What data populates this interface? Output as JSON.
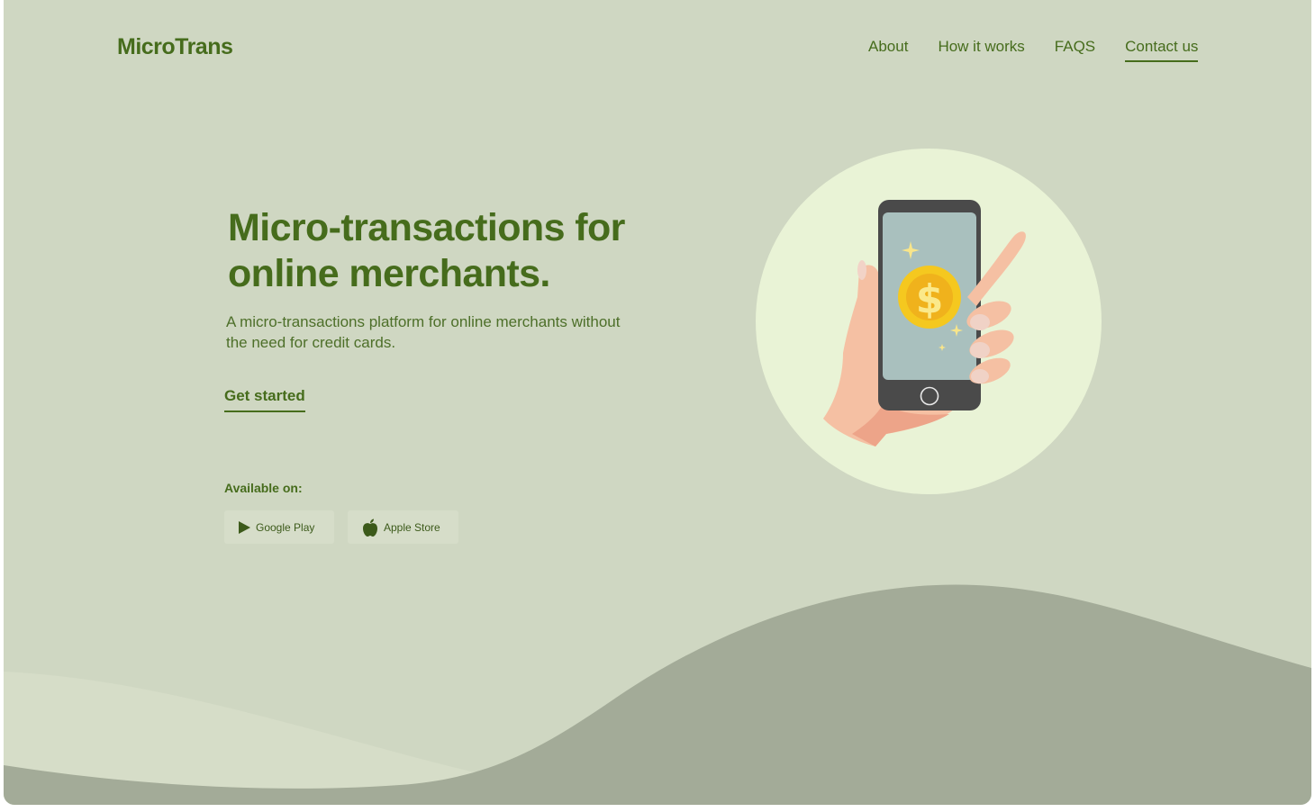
{
  "brand": {
    "name": "MicroTrans"
  },
  "nav": {
    "items": [
      {
        "label": "About"
      },
      {
        "label": "How it works"
      },
      {
        "label": "FAQS"
      },
      {
        "label": "Contact us"
      }
    ]
  },
  "hero": {
    "title": "Micro-transactions for online merchants.",
    "subtitle": "A micro-transactions platform for online merchants without the need for credit cards.",
    "cta_label": "Get started"
  },
  "availability": {
    "heading": "Available on:",
    "stores": [
      {
        "label": "Google Play",
        "icon": "google-play-icon"
      },
      {
        "label": "Apple Store",
        "icon": "apple-icon"
      }
    ]
  },
  "illustration": {
    "icon": "hand-phone-dollar-illustration"
  },
  "colors": {
    "page_bg": "#cfd7c2",
    "primary_text": "#466c1c",
    "circle": "#e9f3d6",
    "wave_dark": "#a3ab98",
    "wave_light": "#d6ddc8"
  }
}
